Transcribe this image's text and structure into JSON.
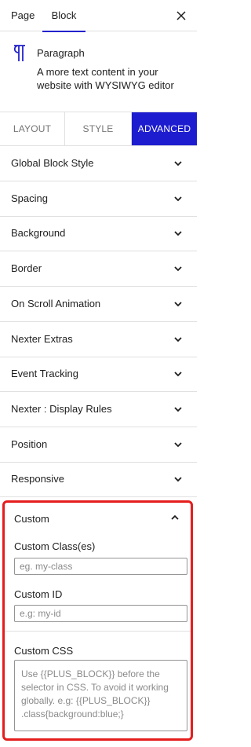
{
  "sidebar_tabs": {
    "page": "Page",
    "block": "Block"
  },
  "close_icon": "close-icon",
  "block": {
    "icon": "paragraph-icon",
    "title": "Paragraph",
    "description": "A more text content in your website with WYSIWYG editor"
  },
  "mode_tabs": {
    "layout": "LAYOUT",
    "style": "STYLE",
    "advanced": "ADVANCED",
    "active": "advanced"
  },
  "accent_color": "#1d1dcf",
  "highlight_color": "#e51d1d",
  "panels": [
    "Global Block Style",
    "Spacing",
    "Background",
    "Border",
    "On Scroll Animation",
    "Nexter Extras",
    "Event Tracking",
    "Nexter : Display Rules",
    "Position",
    "Responsive"
  ],
  "custom": {
    "title": "Custom",
    "expanded": true,
    "class_label": "Custom Class(es)",
    "class_placeholder": "eg. my-class",
    "id_label": "Custom ID",
    "id_placeholder": "e.g: my-id",
    "css_label": "Custom CSS",
    "css_placeholder": "Use {{PLUS_BLOCK}} before the selector in CSS. To avoid it working globally. e.g: {{PLUS_BLOCK}} .class{background:blue;}"
  }
}
